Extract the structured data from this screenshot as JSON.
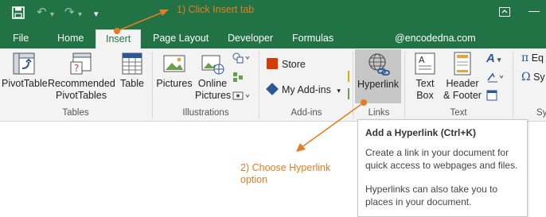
{
  "quick_access": {
    "icons": [
      "save-icon",
      "undo-icon",
      "redo-icon",
      "customize-qat-icon"
    ],
    "undo_glyph": "↶",
    "redo_glyph": "↷",
    "more_glyph": "▾"
  },
  "title_bar": {
    "restore_glyph": "⧉",
    "minimize_glyph": "—"
  },
  "annotations": {
    "step1": "1) Click Insert tab",
    "step2_line1": "2) Choose Hyperlink",
    "step2_line2": "option"
  },
  "tabs": [
    "File",
    "Home",
    "Insert",
    "Page Layout",
    "Developer",
    "Formulas"
  ],
  "active_tab": "Insert",
  "account_email": "@encodedna.com",
  "ribbon": {
    "groups": {
      "tables": "Tables",
      "illustrations": "Illustrations",
      "addins": "Add-ins",
      "links": "Links",
      "text": "Text"
    },
    "pivottable": "PivotTable",
    "recommended_line1": "Recommended",
    "recommended_line2": "PivotTables",
    "table": "Table",
    "pictures": "Pictures",
    "online_line1": "Online",
    "online_line2": "Pictures",
    "store": "Store",
    "my_addins": "My Add-ins",
    "hyperlink": "Hyperlink",
    "textbox_line1": "Text",
    "textbox_line2": "Box",
    "hf_line1": "Header",
    "hf_line2": "& Footer",
    "equation_partial": "Eq",
    "symbol_partial": "Sy",
    "sym_group_partial": "Sy"
  },
  "tooltip": {
    "title": "Add a Hyperlink (Ctrl+K)",
    "p1_line1": "Create a link in your document for",
    "p1_line2": "quick access to webpages and files.",
    "p2_line1": "Hyperlinks can also take you to",
    "p2_line2": "places in your document."
  },
  "colors": {
    "excel_green": "#217346",
    "annotation_orange": "#e47c22",
    "ribbon_bg": "#f3f3f3"
  }
}
